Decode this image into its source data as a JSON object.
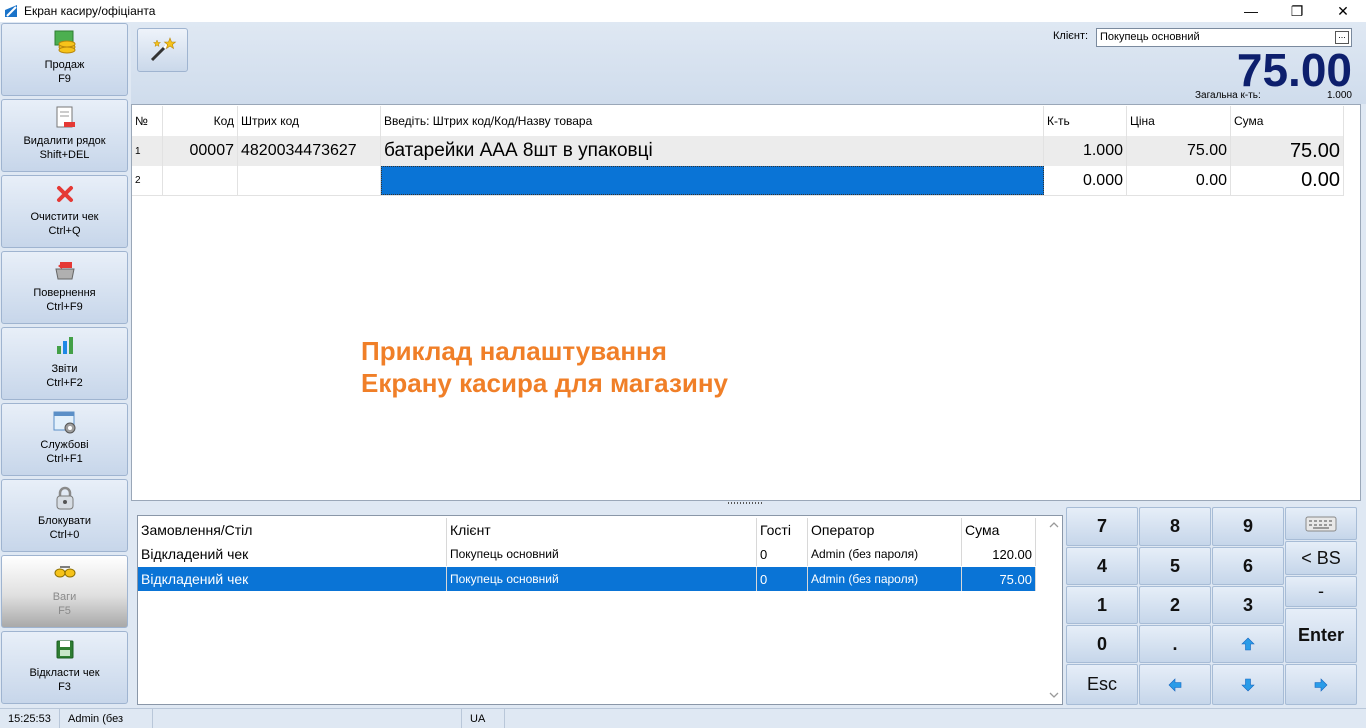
{
  "window": {
    "title": "Екран касиру/офіціанта",
    "controls": {
      "minimize": "—",
      "restore": "❐",
      "close": "✕"
    }
  },
  "sidebar": {
    "items": [
      {
        "label": "Продаж",
        "shortcut": "F9",
        "icon": "coins-icon",
        "enabled": true
      },
      {
        "label": "Видалити рядок",
        "shortcut": "Shift+DEL",
        "icon": "delete-line-icon",
        "enabled": true
      },
      {
        "label": "Очистити чек",
        "shortcut": "Ctrl+Q",
        "icon": "clear-x-icon",
        "enabled": true
      },
      {
        "label": "Повернення",
        "shortcut": "Ctrl+F9",
        "icon": "return-icon",
        "enabled": true
      },
      {
        "label": "Звіти",
        "shortcut": "Ctrl+F2",
        "icon": "reports-icon",
        "enabled": true
      },
      {
        "label": "Службові",
        "shortcut": "Ctrl+F1",
        "icon": "service-icon",
        "enabled": true
      },
      {
        "label": "Блокувати",
        "shortcut": "Ctrl+0",
        "icon": "lock-icon",
        "enabled": true
      },
      {
        "label": "Ваги",
        "shortcut": "F5",
        "icon": "scales-icon",
        "enabled": false
      },
      {
        "label": "Відкласти чек",
        "shortcut": "F3",
        "icon": "save-icon",
        "enabled": true
      }
    ]
  },
  "toolbar": {
    "magic_icon": "magic-wand-icon"
  },
  "header": {
    "client_label": "Клієнт:",
    "client_value": "Покупець основний",
    "client_browse": "...",
    "total": "75.00",
    "total_qty_label": "Загальна к-ть:",
    "total_qty": "1.000"
  },
  "receipt": {
    "columns": {
      "num": "№",
      "code": "Код",
      "barcode": "Штрих код",
      "name": "Введіть: Штрих код/Код/Назву товара",
      "qty": "К-ть",
      "price": "Ціна",
      "sum": "Сума"
    },
    "rows": [
      {
        "num": "1",
        "code": "00007",
        "barcode": "4820034473627",
        "name": "батарейки ААА 8шт в упаковці",
        "qty": "1.000",
        "price": "75.00",
        "sum": "75.00"
      },
      {
        "num": "2",
        "code": "",
        "barcode": "",
        "name": "",
        "qty": "0.000",
        "price": "0.00",
        "sum": "0.00"
      }
    ],
    "caption_line1": "Приклад налаштування",
    "caption_line2": "Екрану касира для магазину"
  },
  "held_checks": {
    "columns": {
      "order": "Замовлення/Стіл",
      "client": "Клієнт",
      "guests": "Гості",
      "operator": "Оператор",
      "sum": "Сума"
    },
    "rows": [
      {
        "order": "Відкладений чек",
        "client": "Покупець основний",
        "guests": "0",
        "operator": "Admin (без пароля)",
        "sum": "120.00",
        "selected": false
      },
      {
        "order": "Відкладений чек",
        "client": "Покупець основний",
        "guests": "0",
        "operator": "Admin (без пароля)",
        "sum": "75.00",
        "selected": true
      }
    ]
  },
  "numpad": {
    "k7": "7",
    "k8": "8",
    "k9": "9",
    "keyboard_icon": "keyboard-icon",
    "k4": "4",
    "k5": "5",
    "k6": "6",
    "backspace": "< BS",
    "k1": "1",
    "k2": "2",
    "k3": "3",
    "minus": "-",
    "k0": "0",
    "dot": ".",
    "up_icon": "arrow-up-icon",
    "enter": "Enter",
    "esc": "Esc",
    "left_icon": "arrow-left-icon",
    "down_icon": "arrow-down-icon",
    "right_icon": "arrow-right-icon"
  },
  "statusbar": {
    "time": "15:25:53",
    "user": "Admin (без",
    "lang": "UA"
  },
  "colors": {
    "selection": "#0a74d6",
    "total": "#0d1f6d",
    "caption": "#f07f28",
    "panel": "#dfe8f3"
  }
}
